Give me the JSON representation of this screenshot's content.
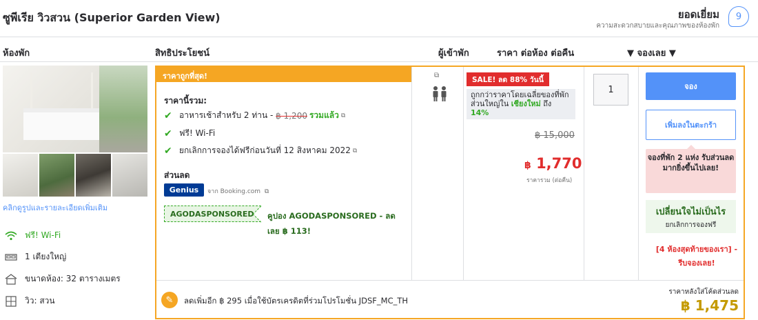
{
  "room": {
    "title": "ซูพีเรีย วิวสวน (Superior Garden View)"
  },
  "rating": {
    "label": "ยอดเยี่ยม",
    "sub": "ความสะดวกสบายและคุณภาพของห้องพัก",
    "score": "9"
  },
  "columns": {
    "room": "ห้องพัก",
    "benefits": "สิทธิประโยชน์",
    "guests": "ผู้เข้าพัก",
    "price": "ราคา ต่อห้อง ต่อคืน",
    "book": "▼ จองเลย ▼"
  },
  "photos": {
    "link": "คลิกดูรูปและรายละเอียดเพิ่มเติม"
  },
  "features": [
    {
      "icon": "wifi-icon",
      "label": "ฟรี! Wi-Fi"
    },
    {
      "icon": "bed-icon",
      "label": "1 เตียงใหญ่"
    },
    {
      "icon": "house-icon",
      "label": "ขนาดห้อง: 32 ตารางเมตร"
    },
    {
      "icon": "window-icon",
      "label": "วิว: สวน"
    }
  ],
  "offer": {
    "banner": "ราคาถูกที่สุด!",
    "included_title": "ราคานี้รวม:",
    "breakfast": "อาหารเช้าสำหรับ 2 ท่าน -",
    "breakfast_old": "฿ 1,200",
    "breakfast_included": "รวมแล้ว",
    "wifi": "ฟรี! Wi-Fi",
    "cancel": "ยกเลิกการจองได้ฟรีก่อนวันที่ 12 สิงหาคม 2022",
    "discount_title": "ส่วนลด",
    "genius": "Genius",
    "booking_source": "จาก Booking.com",
    "coupon_code": "AGODASPONSORED",
    "coupon_text": "คูปอง AGODASPONSORED - ลดเลย ฿ 113!"
  },
  "price": {
    "sale": "SALE! ลด 88% วันนี้",
    "cheaper_text": "ถูกกว่าราคาโดยเฉลี่ยของที่พักส่วนใหญ่ใน",
    "cheaper_city": "เชียงใหม่",
    "cheaper_mid": "ถึง",
    "cheaper_pct": "14%",
    "old": "฿ 15,000",
    "currency": "฿",
    "new": "1,770",
    "sub": "ราคารวม (ต่อคืน)"
  },
  "quantity": "1",
  "actions": {
    "book": "จอง",
    "add_cart": "เพิ่มลงในตะกร้า",
    "tip": "จองที่พัก 2 แห่ง รับส่วนลดมากยิ่งขึ้นไปเลย!",
    "mind_title": "เปลี่ยนใจไม่เป็นไร",
    "mind_sub": "ยกเลิกการจองฟรี",
    "urgent": "[4 ห้องสุดท้ายของเรา] - รีบจองเลย!"
  },
  "promo": {
    "text": "ลดเพิ่มอีก ฿ 295 เมื่อใช้บัตรเครดิตที่ร่วมโปรโมชั่น JDSF_MC_TH",
    "final_label": "ราคาหลังใส่โค้ดส่วนลด",
    "final_price": "฿ 1,475"
  },
  "colors": {
    "accent_orange": "#f5a623",
    "brand_blue": "#5392f9",
    "sale_red": "#e12d2d",
    "success_green": "#32a923",
    "final_gold": "#c49a00"
  }
}
